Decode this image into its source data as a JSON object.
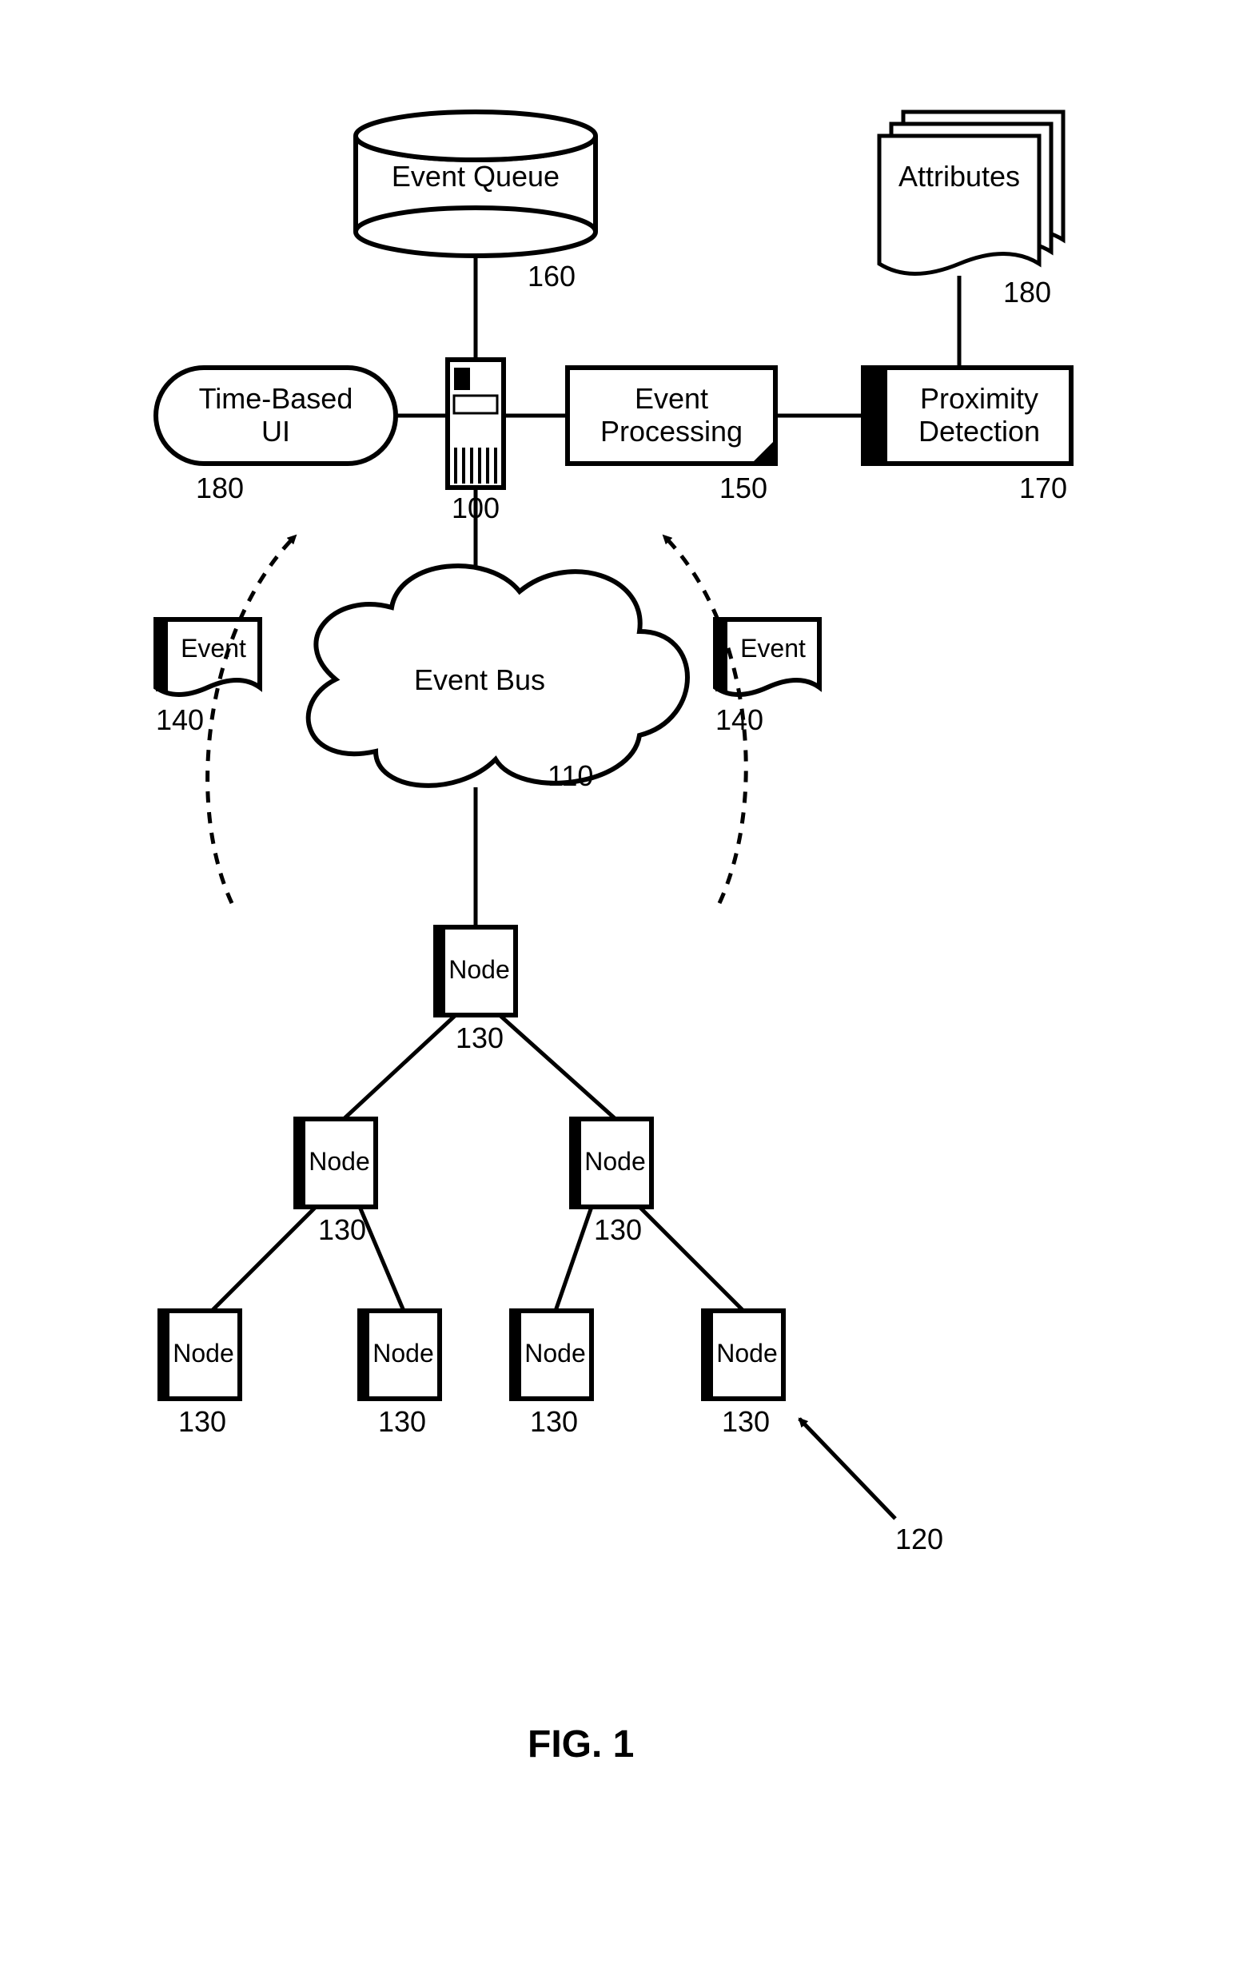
{
  "figure": {
    "caption": "FIG. 1"
  },
  "nodes": {
    "event_queue": {
      "label": "Event Queue",
      "num": "160"
    },
    "time_based_ui": {
      "label": "Time-Based\nUI",
      "num": "180"
    },
    "server": {
      "label": "",
      "num": "100"
    },
    "event_processing": {
      "label": "Event\nProcessing",
      "num": "150"
    },
    "proximity": {
      "label": "Proximity\nDetection",
      "num": "170"
    },
    "attributes": {
      "label": "Attributes",
      "num": "180"
    },
    "event_bus": {
      "label": "Event Bus",
      "num": "110"
    },
    "event_left": {
      "label": "Event",
      "num": "140"
    },
    "event_right": {
      "label": "Event",
      "num": "140"
    },
    "node_root": {
      "label": "Node",
      "num": "130"
    },
    "node_l": {
      "label": "Node",
      "num": "130"
    },
    "node_r": {
      "label": "Node",
      "num": "130"
    },
    "node_ll": {
      "label": "Node",
      "num": "130"
    },
    "node_lr": {
      "label": "Node",
      "num": "130"
    },
    "node_rl": {
      "label": "Node",
      "num": "130"
    },
    "node_rr": {
      "label": "Node",
      "num": "130"
    },
    "tree_ref": {
      "num": "120"
    }
  }
}
